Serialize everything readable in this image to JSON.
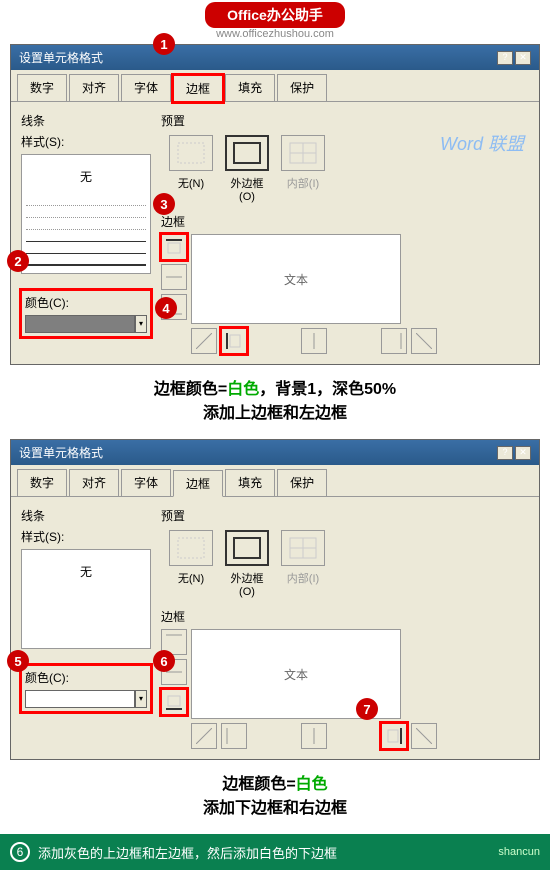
{
  "banner": {
    "title": "Office办公助手",
    "url": "www.officezhushou.com"
  },
  "dialog": {
    "title": "设置单元格格式",
    "tabs": [
      "数字",
      "对齐",
      "字体",
      "边框",
      "填充",
      "保护"
    ],
    "active_tab": 3,
    "lines_group": "线条",
    "style_label": "样式(S):",
    "style_none": "无",
    "color_label": "颜色(C):",
    "preset_group": "预置",
    "presets": {
      "none": "无(N)",
      "outer": "外边框(O)",
      "inner": "内部(I)"
    },
    "border_group": "边框",
    "preview_text": "文本"
  },
  "caption1": {
    "line1_a": "边框颜色=",
    "line1_b": "白色",
    "line1_c": "，背景1，深色50%",
    "line2": "添加上边框和左边框"
  },
  "caption2": {
    "line1_a": "边框颜色=",
    "line1_b": "白色",
    "line2": "添加下边框和右边框"
  },
  "markers": {
    "m1": "1",
    "m2": "2",
    "m3": "3",
    "m4": "4",
    "m5": "5",
    "m6": "6",
    "m7": "7"
  },
  "footer": {
    "num": "6",
    "text": "添加灰色的上边框和左边框，然后添加白色的下边框",
    "logo": "shancun"
  },
  "watermark": "Word 联盟"
}
